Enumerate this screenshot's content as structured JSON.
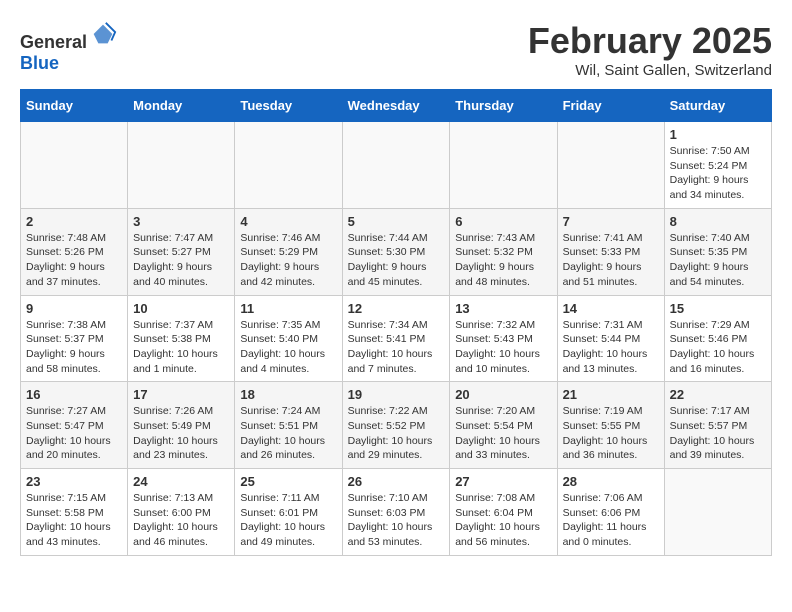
{
  "header": {
    "logo": {
      "text_general": "General",
      "text_blue": "Blue"
    },
    "title": "February 2025",
    "location": "Wil, Saint Gallen, Switzerland"
  },
  "weekdays": [
    "Sunday",
    "Monday",
    "Tuesday",
    "Wednesday",
    "Thursday",
    "Friday",
    "Saturday"
  ],
  "weeks": [
    [
      {
        "day": "",
        "info": ""
      },
      {
        "day": "",
        "info": ""
      },
      {
        "day": "",
        "info": ""
      },
      {
        "day": "",
        "info": ""
      },
      {
        "day": "",
        "info": ""
      },
      {
        "day": "",
        "info": ""
      },
      {
        "day": "1",
        "info": "Sunrise: 7:50 AM\nSunset: 5:24 PM\nDaylight: 9 hours and 34 minutes."
      }
    ],
    [
      {
        "day": "2",
        "info": "Sunrise: 7:48 AM\nSunset: 5:26 PM\nDaylight: 9 hours and 37 minutes."
      },
      {
        "day": "3",
        "info": "Sunrise: 7:47 AM\nSunset: 5:27 PM\nDaylight: 9 hours and 40 minutes."
      },
      {
        "day": "4",
        "info": "Sunrise: 7:46 AM\nSunset: 5:29 PM\nDaylight: 9 hours and 42 minutes."
      },
      {
        "day": "5",
        "info": "Sunrise: 7:44 AM\nSunset: 5:30 PM\nDaylight: 9 hours and 45 minutes."
      },
      {
        "day": "6",
        "info": "Sunrise: 7:43 AM\nSunset: 5:32 PM\nDaylight: 9 hours and 48 minutes."
      },
      {
        "day": "7",
        "info": "Sunrise: 7:41 AM\nSunset: 5:33 PM\nDaylight: 9 hours and 51 minutes."
      },
      {
        "day": "8",
        "info": "Sunrise: 7:40 AM\nSunset: 5:35 PM\nDaylight: 9 hours and 54 minutes."
      }
    ],
    [
      {
        "day": "9",
        "info": "Sunrise: 7:38 AM\nSunset: 5:37 PM\nDaylight: 9 hours and 58 minutes."
      },
      {
        "day": "10",
        "info": "Sunrise: 7:37 AM\nSunset: 5:38 PM\nDaylight: 10 hours and 1 minute."
      },
      {
        "day": "11",
        "info": "Sunrise: 7:35 AM\nSunset: 5:40 PM\nDaylight: 10 hours and 4 minutes."
      },
      {
        "day": "12",
        "info": "Sunrise: 7:34 AM\nSunset: 5:41 PM\nDaylight: 10 hours and 7 minutes."
      },
      {
        "day": "13",
        "info": "Sunrise: 7:32 AM\nSunset: 5:43 PM\nDaylight: 10 hours and 10 minutes."
      },
      {
        "day": "14",
        "info": "Sunrise: 7:31 AM\nSunset: 5:44 PM\nDaylight: 10 hours and 13 minutes."
      },
      {
        "day": "15",
        "info": "Sunrise: 7:29 AM\nSunset: 5:46 PM\nDaylight: 10 hours and 16 minutes."
      }
    ],
    [
      {
        "day": "16",
        "info": "Sunrise: 7:27 AM\nSunset: 5:47 PM\nDaylight: 10 hours and 20 minutes."
      },
      {
        "day": "17",
        "info": "Sunrise: 7:26 AM\nSunset: 5:49 PM\nDaylight: 10 hours and 23 minutes."
      },
      {
        "day": "18",
        "info": "Sunrise: 7:24 AM\nSunset: 5:51 PM\nDaylight: 10 hours and 26 minutes."
      },
      {
        "day": "19",
        "info": "Sunrise: 7:22 AM\nSunset: 5:52 PM\nDaylight: 10 hours and 29 minutes."
      },
      {
        "day": "20",
        "info": "Sunrise: 7:20 AM\nSunset: 5:54 PM\nDaylight: 10 hours and 33 minutes."
      },
      {
        "day": "21",
        "info": "Sunrise: 7:19 AM\nSunset: 5:55 PM\nDaylight: 10 hours and 36 minutes."
      },
      {
        "day": "22",
        "info": "Sunrise: 7:17 AM\nSunset: 5:57 PM\nDaylight: 10 hours and 39 minutes."
      }
    ],
    [
      {
        "day": "23",
        "info": "Sunrise: 7:15 AM\nSunset: 5:58 PM\nDaylight: 10 hours and 43 minutes."
      },
      {
        "day": "24",
        "info": "Sunrise: 7:13 AM\nSunset: 6:00 PM\nDaylight: 10 hours and 46 minutes."
      },
      {
        "day": "25",
        "info": "Sunrise: 7:11 AM\nSunset: 6:01 PM\nDaylight: 10 hours and 49 minutes."
      },
      {
        "day": "26",
        "info": "Sunrise: 7:10 AM\nSunset: 6:03 PM\nDaylight: 10 hours and 53 minutes."
      },
      {
        "day": "27",
        "info": "Sunrise: 7:08 AM\nSunset: 6:04 PM\nDaylight: 10 hours and 56 minutes."
      },
      {
        "day": "28",
        "info": "Sunrise: 7:06 AM\nSunset: 6:06 PM\nDaylight: 11 hours and 0 minutes."
      },
      {
        "day": "",
        "info": ""
      }
    ]
  ]
}
